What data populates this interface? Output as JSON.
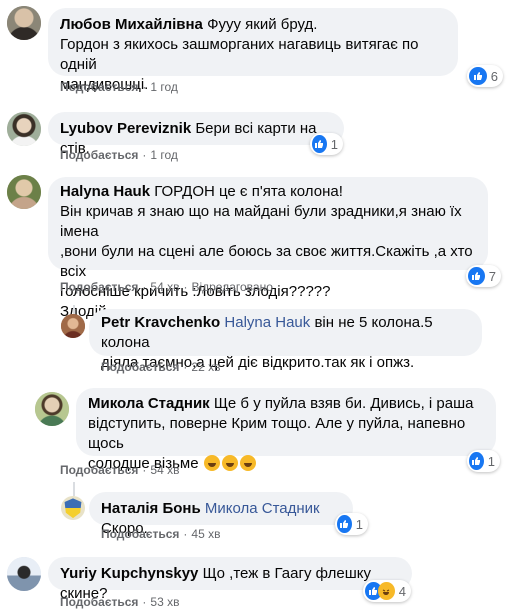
{
  "actions": {
    "like": "Подобається",
    "reply_sep": "·"
  },
  "colors": {
    "bubble_bg": "#f0f2f5",
    "link": "#385898",
    "like_blue": "#1877f2",
    "haha_yellow": "#f7b928"
  },
  "comments": [
    {
      "author": "Любов Михайлівна",
      "lines": [
        "Фууу який бруд.",
        "Гордон з якихось зашморганих нагавиць витягає по одній",
        "мандивошці."
      ],
      "time": "1 год",
      "reaction_count": "6",
      "reaction_icons": [
        "like-icon"
      ]
    },
    {
      "author": "Lyubov Pereviznik",
      "lines": [
        "Бери всі карти на стів."
      ],
      "time": "1 год",
      "reaction_count": "1",
      "reaction_icons": [
        "like-icon"
      ]
    },
    {
      "author": "Halyna Hauk",
      "lines": [
        "ГОРДОН це є п'ята колона!",
        "Він кричав я знаю що на майдані були зрадники,я знаю їх імена",
        ",вони були на сцені але боюсь за своє життя.Скажіть ,а хто всіх",
        "голосніше кричить :Ловіть злодія?????",
        "Злодій."
      ],
      "time": "54 хв",
      "edited": "Відредаговано",
      "reaction_count": "7",
      "reaction_icons": [
        "like-icon"
      ]
    },
    {
      "author": "Petr Kravchenko",
      "tag": "Halyna Hauk",
      "lines": [
        "він не 5 колона.5 колона",
        "діяла таємно,а цей діє відкрито.так як і опжз."
      ],
      "time": "22 хв"
    },
    {
      "author": "Микола Стадник",
      "lines": [
        "Ще б у пуйла взяв би. Дивись, і раша",
        "відступить, поверне Крим тощо. Але у пуйла, напевно щось",
        "солодше візьме"
      ],
      "time": "54 хв",
      "reaction_count": "1",
      "reaction_icons": [
        "like-icon"
      ]
    },
    {
      "author": "Наталія Бонь",
      "tag": "Микола Стадник",
      "lines": [
        "Скоро."
      ],
      "time": "45 хв",
      "reaction_count": "1",
      "reaction_icons": [
        "like-icon"
      ]
    },
    {
      "author": "Yuriy Kupchynskyy",
      "lines": [
        "Що ,теж в Гаагу флешку скине?"
      ],
      "time": "53 хв",
      "reaction_count": "4",
      "reaction_icons": [
        "like-icon",
        "haha-icon"
      ]
    }
  ]
}
